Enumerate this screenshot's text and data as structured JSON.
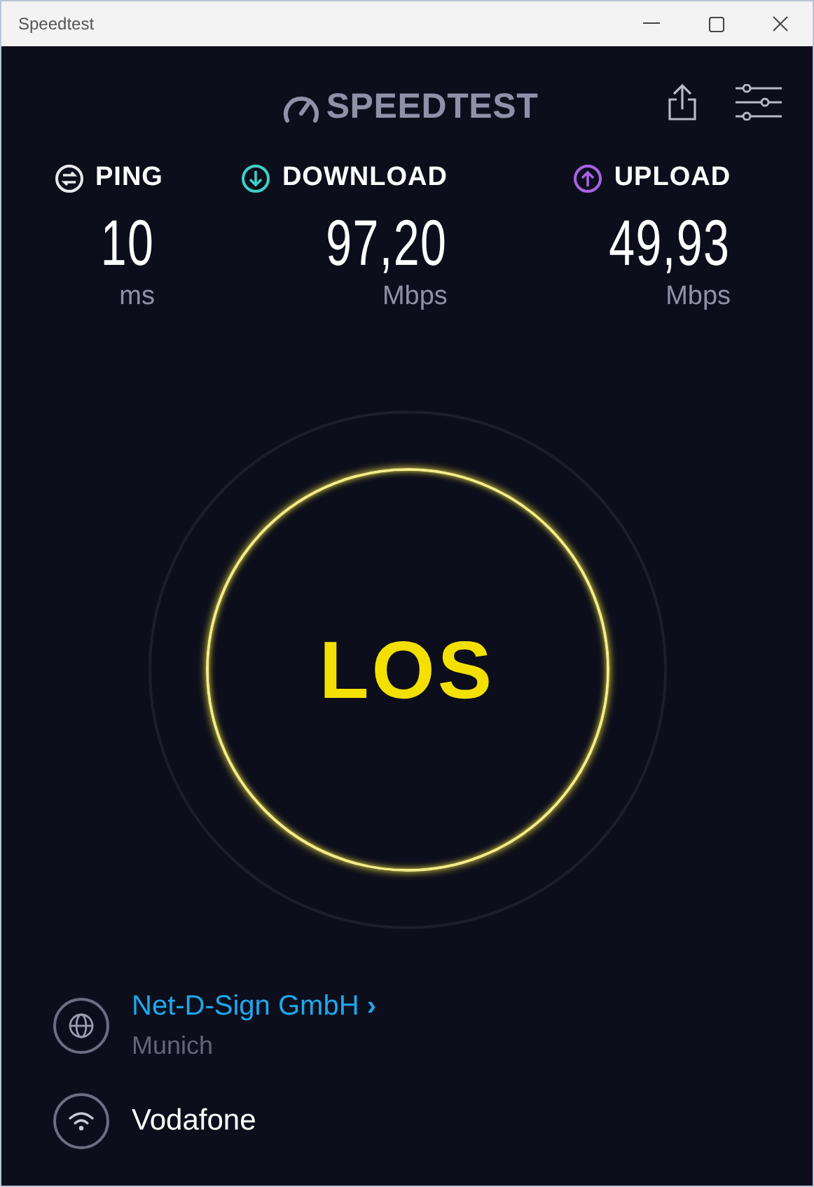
{
  "window": {
    "title": "Speedtest"
  },
  "logo": {
    "text": "SPEEDTEST"
  },
  "metrics": [
    {
      "kind": "ping",
      "label": "PING",
      "value": "10",
      "unit": "ms",
      "color": "#e8e8ee"
    },
    {
      "kind": "download",
      "label": "DOWNLOAD",
      "value": "97,20",
      "unit": "Mbps",
      "color": "#3ecfc5"
    },
    {
      "kind": "upload",
      "label": "UPLOAD",
      "value": "49,93",
      "unit": "Mbps",
      "color": "#a863e6"
    }
  ],
  "go_button": {
    "label": "LOS"
  },
  "server": {
    "name": "Net-D-Sign GmbH",
    "chevron": "›",
    "location": "Munich"
  },
  "provider": {
    "name": "Vodafone"
  }
}
